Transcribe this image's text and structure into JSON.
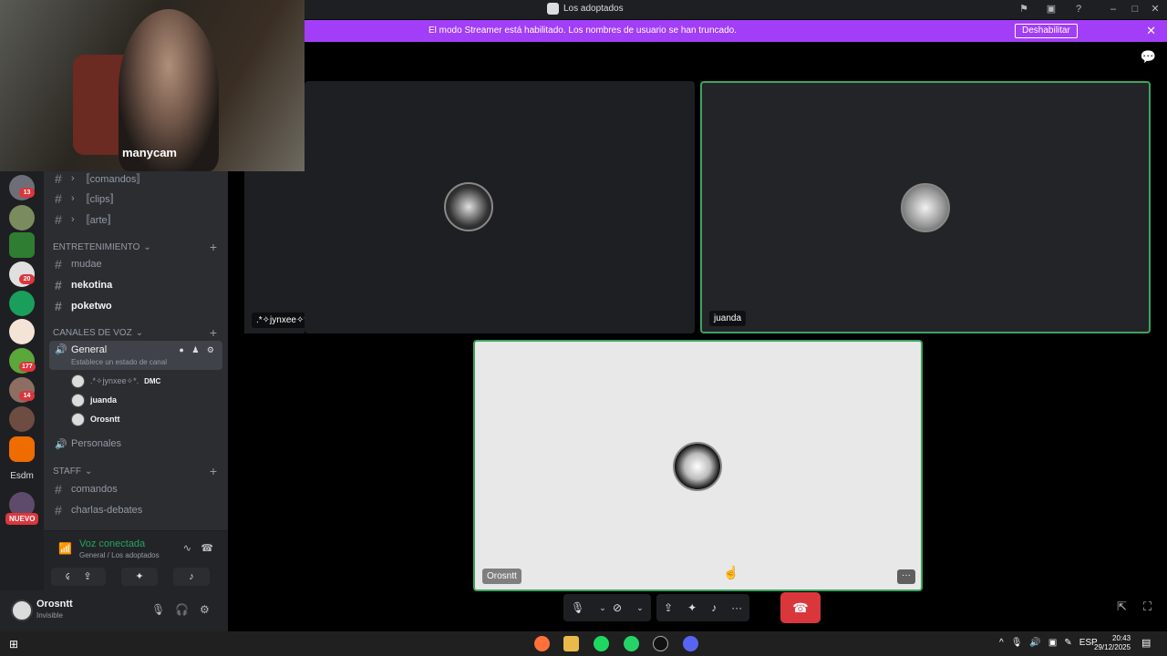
{
  "window": {
    "title": "Los adoptados"
  },
  "banner": {
    "message": "El modo Streamer está habilitado. Los nombres de usuario se han truncado.",
    "disable_label": "Deshabilitar",
    "color": "#a23ef7"
  },
  "webcam": {
    "watermark": "manycam"
  },
  "server_rail": {
    "badges": [
      "13",
      "20",
      "177",
      "14"
    ],
    "texts": [
      "Esdm"
    ],
    "new_label": "NUEVO"
  },
  "sidebar": {
    "channels_top": [
      {
        "label": "〚comandos〛"
      },
      {
        "label": "〚clips〛"
      },
      {
        "label": "〚arte〛"
      }
    ],
    "cat_entertainment": "ENTRETENIMIENTO",
    "entertainment_channels": [
      {
        "label": "mudae"
      },
      {
        "label": "nekotina"
      },
      {
        "label": "poketwo"
      }
    ],
    "cat_voice": "CANALES DE VOZ",
    "voice_channel": {
      "name": "General",
      "status": "Establece un estado de canal"
    },
    "voice_users": [
      {
        "name": ".*✧jynxee✧*.",
        "tag": "DMC"
      },
      {
        "name": "juanda"
      },
      {
        "name": "Orosntt"
      }
    ],
    "personal": "Personales",
    "cat_staff": "STAFF",
    "staff_channels": [
      {
        "label": "comandos"
      },
      {
        "label": "charlas-debates"
      }
    ]
  },
  "voice_panel": {
    "status": "Voz conectada",
    "location": "General / Los adoptados"
  },
  "user_panel": {
    "name": "Orosntt",
    "status": "Invisible"
  },
  "tiles": [
    {
      "label": ".*✧jynxee✧*."
    },
    {
      "label": "juanda"
    },
    {
      "label": "Orosntt"
    }
  ],
  "taskbar": {
    "lang": "ESP",
    "time": "20:43",
    "date": "29/12/2025"
  },
  "colors": {
    "speaking_border": "#3ba55d",
    "hangup": "#da373c",
    "connected": "#23a55a"
  }
}
